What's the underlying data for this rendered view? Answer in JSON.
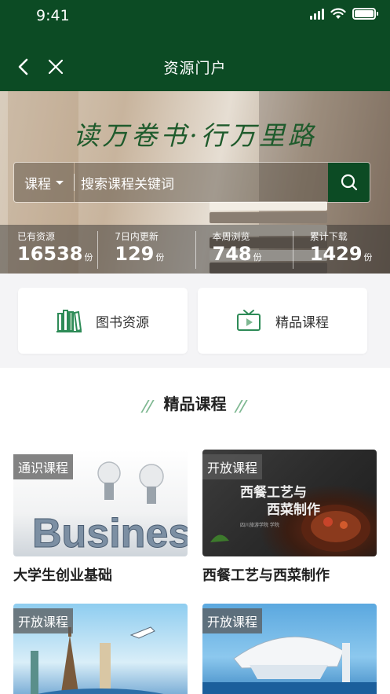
{
  "status_bar": {
    "time": "9:41"
  },
  "header": {
    "title": "资源门户"
  },
  "banner": {
    "slogan": "读万卷书·行万里路",
    "search": {
      "category": "课程",
      "placeholder": "搜索课程关键词"
    },
    "stats": [
      {
        "label": "已有资源",
        "value": "16538",
        "unit": "份"
      },
      {
        "label": "7日内更新",
        "value": "129",
        "unit": "份"
      },
      {
        "label": "本周浏览",
        "value": "748",
        "unit": "份"
      },
      {
        "label": "累计下载",
        "value": "1429",
        "unit": "份"
      }
    ]
  },
  "categories": [
    {
      "label": "图书资源",
      "icon": "books-icon"
    },
    {
      "label": "精品课程",
      "icon": "tv-play-icon"
    }
  ],
  "featured": {
    "title": "精品课程",
    "courses": [
      {
        "tag": "通识课程",
        "name": "大学生创业基础"
      },
      {
        "tag": "开放课程",
        "name": "西餐工艺与西菜制作"
      },
      {
        "tag": "开放课程",
        "name": ""
      },
      {
        "tag": "开放课程",
        "name": ""
      }
    ]
  },
  "images": {
    "course_1_word": "Business",
    "course_2_text": "西餐工艺与\n西菜制作",
    "course_2_sub": "四川旅游学院  学院"
  },
  "colors": {
    "brand": "#0c4b24",
    "accent": "#2e8b57",
    "light_green": "#7fb892"
  }
}
